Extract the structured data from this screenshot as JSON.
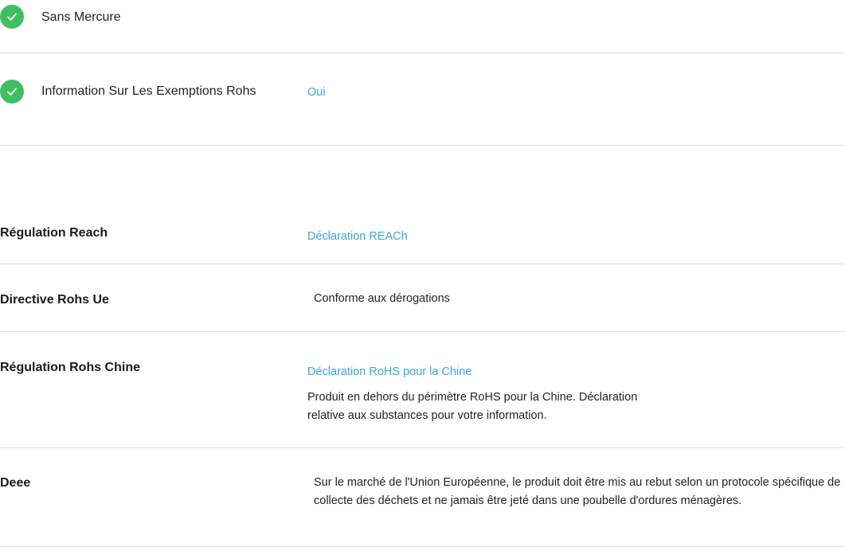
{
  "checks": [
    {
      "label": "Sans Mercure",
      "value": ""
    },
    {
      "label": "Information Sur Les Exemptions Rohs",
      "value": "Oui"
    }
  ],
  "specs": {
    "reach": {
      "label": "Régulation Reach",
      "link": "Déclaration REACh"
    },
    "rohs_ue": {
      "label": "Directive Rohs Ue",
      "value": "Conforme aux dérogations"
    },
    "rohs_chine": {
      "label": "Régulation Rohs Chine",
      "link": "Déclaration RoHS pour la Chine",
      "description": "Produit en dehors du périmètre RoHS pour la Chine. Déclaration relative aux substances pour votre information."
    },
    "deee": {
      "label": "Deee",
      "description": "Sur le marché de l'Union Européenne, le produit doit être mis au rebut selon un protocole spécifique de collecte des déchets et ne jamais être jeté dans une poubelle d'ordures ménagères."
    }
  },
  "colors": {
    "check_green": "#3fbf5f",
    "link_blue": "#3aa8d8",
    "divider": "#dcdcdc"
  }
}
